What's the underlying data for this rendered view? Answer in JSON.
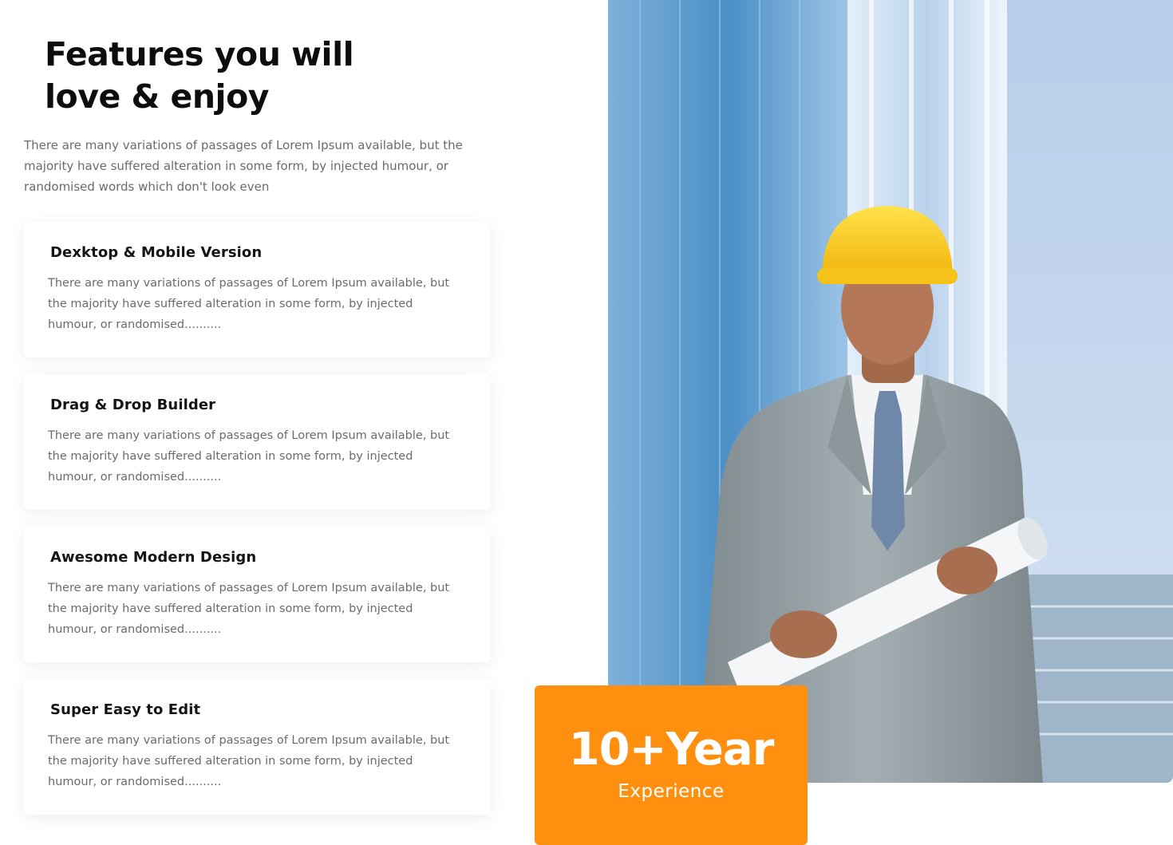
{
  "section": {
    "title_line1": "Features you will",
    "title_line2": "love & enjoy",
    "intro": "There are many variations of passages of Lorem Ipsum available, but the majority have suffered alteration in some form, by injected humour, or randomised words which don't look even"
  },
  "features": [
    {
      "title": "Dexktop & Mobile Version",
      "text": "There are many variations of passages of Lorem Ipsum available, but the majority have suffered alteration in some form, by injected humour, or randomised..........",
      "icon": ""
    },
    {
      "title": "Drag & Drop Builder",
      "text": "There are many variations of passages of Lorem Ipsum available, but the majority have suffered alteration in some form, by injected humour, or randomised.........."
    },
    {
      "title": "Awesome Modern Design",
      "text": "There are many variations of passages of Lorem Ipsum available, but the majority have suffered alteration in some form, by injected humour, or randomised.........."
    },
    {
      "title": "Super Easy to Edit",
      "text": "There are many variations of passages of Lorem Ipsum available, but the majority have suffered alteration in some form, by injected humour, or randomised.........."
    }
  ],
  "badge": {
    "value": "10+Year",
    "label": "Experience"
  },
  "colors": {
    "accent": "#ff8f0f",
    "heading": "#0d0d0d",
    "body_text": "#6b6b6b"
  }
}
